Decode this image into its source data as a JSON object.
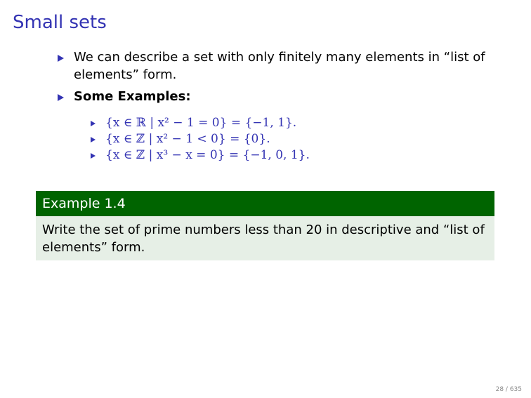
{
  "slide": {
    "title": "Small sets"
  },
  "bullets": [
    {
      "text": "We can describe a set with only finitely many elements in “list of elements” form."
    },
    {
      "text": "Some Examples:",
      "sub_items": [
        "{x ∈ ℝ | x² − 1 = 0} = {−1, 1}.",
        "{x ∈ ℤ | x² − 1 < 0} = {0}.",
        "{x ∈ ℤ | x³ − x = 0} = {−1, 0, 1}."
      ]
    }
  ],
  "example": {
    "heading": "Example 1.4",
    "body": "Write the set of prime numbers less than 20 in descriptive and “list of elements” form."
  },
  "footer": {
    "page_number": "28 / 635"
  },
  "colors": {
    "title": "#3333b3",
    "example_header": "#006400",
    "example_body_bg": "#e6efe6"
  }
}
